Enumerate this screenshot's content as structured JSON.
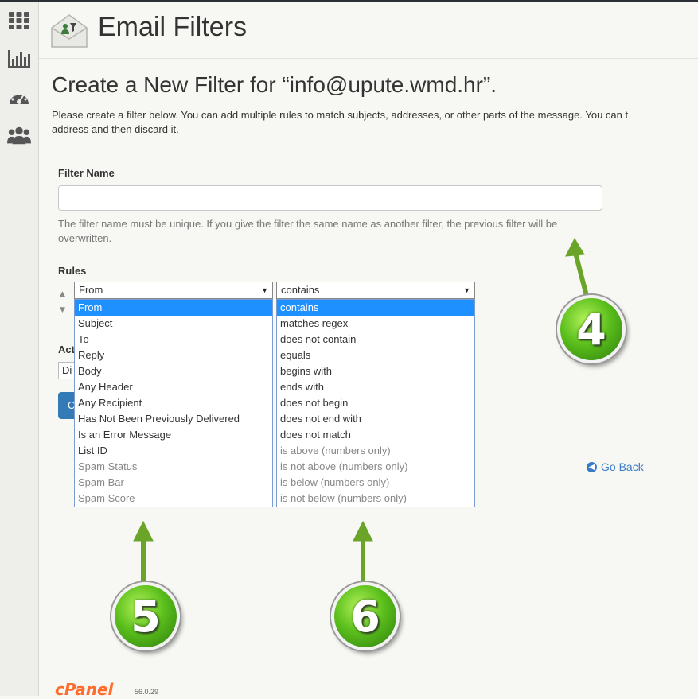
{
  "header": {
    "title": "Email Filters"
  },
  "page": {
    "title": "Create a New Filter for “info@upute.wmd.hr”.",
    "intro_line1": "Please create a filter below. You can add multiple rules to match subjects, addresses, or other parts of the message. You can t",
    "intro_line2": "address and then discard it."
  },
  "filter_name": {
    "label": "Filter Name",
    "value": "",
    "help": "The filter name must be unique. If you give the filter the same name as another filter, the previous filter will be overwritten."
  },
  "rules": {
    "label": "Rules",
    "field_select": {
      "selected": "From",
      "options": [
        "From",
        "Subject",
        "To",
        "Reply",
        "Body",
        "Any Header",
        "Any Recipient",
        "Has Not Been Previously Delivered",
        "Is an Error Message",
        "List ID",
        "Spam Status",
        "Spam Bar",
        "Spam Score"
      ],
      "dim_from_index": 10
    },
    "op_select": {
      "selected": "contains",
      "options": [
        "contains",
        "matches regex",
        "does not contain",
        "equals",
        "begins with",
        "ends with",
        "does not begin",
        "does not end with",
        "does not match",
        "is above (numbers only)",
        "is not above (numbers only)",
        "is below (numbers only)",
        "is not below (numbers only)"
      ],
      "dim_from_index": 9
    }
  },
  "actions": {
    "label_partial": "Act",
    "select_partial": "Di",
    "button_partial": "C"
  },
  "go_back": "Go Back",
  "annotations": {
    "badge_4": "4",
    "badge_5": "5",
    "badge_6": "6",
    "arrow_color": "#6aa52a"
  },
  "footer": {
    "logo": "cPanel",
    "version": "56.0.29"
  },
  "colors": {
    "accent_blue": "#1e90ff",
    "link_blue": "#3a7bc8",
    "badge_green": "#5bbf1c"
  }
}
